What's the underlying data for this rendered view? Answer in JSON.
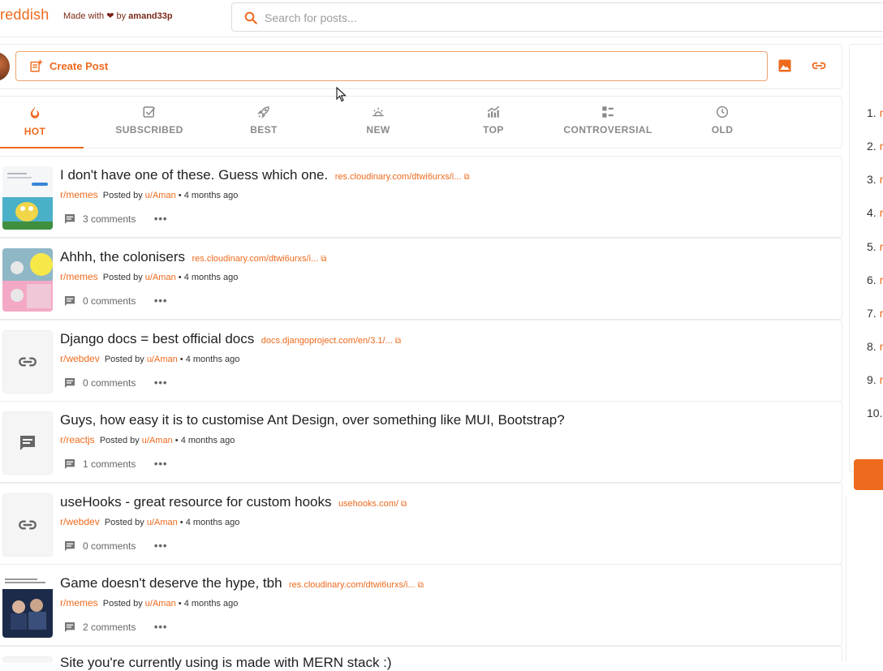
{
  "header": {
    "logo": "reddish",
    "made_with_prefix": "Made with",
    "made_with_by": "by",
    "author": "amand33p",
    "search_placeholder": "Search for posts..."
  },
  "create_post": {
    "label": "Create Post"
  },
  "tabs": [
    {
      "label": "HOT",
      "icon": "fire-icon",
      "active": true
    },
    {
      "label": "SUBSCRIBED",
      "icon": "checkbox-icon"
    },
    {
      "label": "BEST",
      "icon": "rocket-icon"
    },
    {
      "label": "NEW",
      "icon": "sun-icon"
    },
    {
      "label": "TOP",
      "icon": "trending-up-icon"
    },
    {
      "label": "CONTROVERSIAL",
      "icon": "group-icon"
    },
    {
      "label": "OLD",
      "icon": "history-icon"
    }
  ],
  "posts": [
    {
      "title": "I don't have one of these. Guess which one.",
      "link": "res.cloudinary.com/dtwi6urxs/i...",
      "subreddit": "r/memes",
      "posted_by": "Posted by",
      "user": "u/Aman",
      "time": "4 months ago",
      "comments": "3 comments",
      "thumb": "image"
    },
    {
      "title": "Ahhh, the colonisers",
      "link": "res.cloudinary.com/dtwi6urxs/i...",
      "subreddit": "r/memes",
      "posted_by": "Posted by",
      "user": "u/Aman",
      "time": "4 months ago",
      "comments": "0 comments",
      "thumb": "image"
    },
    {
      "title": "Django docs = best official docs",
      "link": "docs.djangoproject.com/en/3.1/...",
      "subreddit": "r/webdev",
      "posted_by": "Posted by",
      "user": "u/Aman",
      "time": "4 months ago",
      "comments": "0 comments",
      "thumb": "link-icon"
    },
    {
      "title": "Guys, how easy it is to customise Ant Design, over something like MUI, Bootstrap?",
      "link": "",
      "subreddit": "r/reactjs",
      "posted_by": "Posted by",
      "user": "u/Aman",
      "time": "4 months ago",
      "comments": "1 comments",
      "thumb": "message-icon"
    },
    {
      "title": "useHooks - great resource for custom hooks",
      "link": "usehooks.com/",
      "subreddit": "r/webdev",
      "posted_by": "Posted by",
      "user": "u/Aman",
      "time": "4 months ago",
      "comments": "0 comments",
      "thumb": "link-icon"
    },
    {
      "title": "Game doesn't deserve the hype, tbh",
      "link": "res.cloudinary.com/dtwi6urxs/i...",
      "subreddit": "r/memes",
      "posted_by": "Posted by",
      "user": "u/Aman",
      "time": "4 months ago",
      "comments": "2 comments",
      "thumb": "image"
    },
    {
      "title": "Site you're currently using is made with MERN stack :)",
      "link": "",
      "subreddit": "",
      "posted_by": "",
      "user": "",
      "time": "",
      "comments": "",
      "thumb": "link-icon"
    }
  ],
  "sidebar": {
    "ranks": [
      "1.",
      "2.",
      "3.",
      "4.",
      "5.",
      "6.",
      "7.",
      "8.",
      "9.",
      "10."
    ],
    "rank_item": "r"
  },
  "colors": {
    "accent": "#ee6a1d",
    "border": "#ececec"
  },
  "separator": "•",
  "external_icon": "⧉"
}
